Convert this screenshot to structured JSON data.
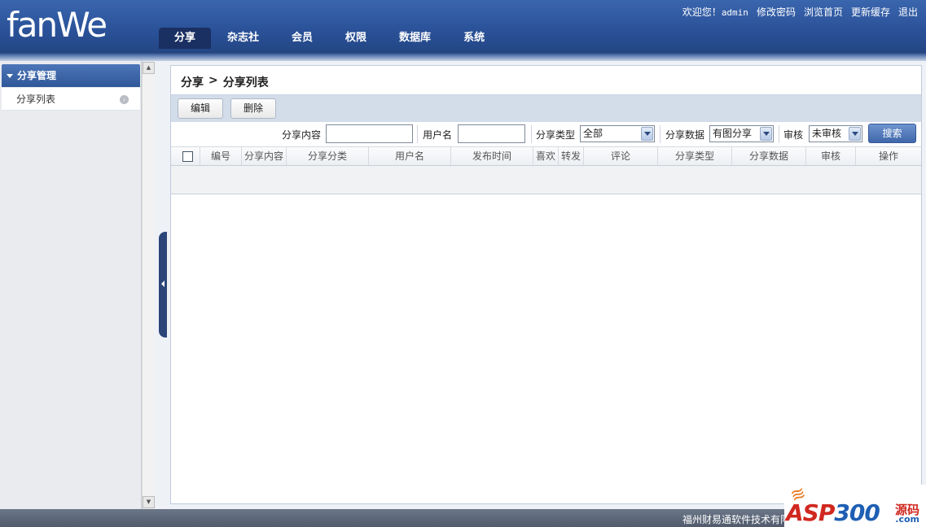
{
  "header": {
    "logo_text": "fanWe",
    "welcome": "欢迎您！",
    "username": "admin",
    "links": [
      "修改密码",
      "浏览首页",
      "更新缓存",
      "退出"
    ],
    "tabs": [
      "分享",
      "杂志社",
      "会员",
      "权限",
      "数据库",
      "系统"
    ],
    "active_tab": "分享"
  },
  "sidebar": {
    "section_title": "分享管理",
    "items": [
      {
        "label": "分享列表"
      }
    ]
  },
  "main": {
    "breadcrumb": [
      "分享",
      ">",
      "分享列表"
    ],
    "toolbar": {
      "edit_label": "编辑",
      "delete_label": "删除"
    },
    "filters": {
      "content_label": "分享内容",
      "content_value": "",
      "username_label": "用户名",
      "username_value": "",
      "type_label": "分享类型",
      "type_value": "全部",
      "data_label": "分享数据",
      "data_value": "有图分享",
      "status_label": "审核",
      "status_value": "未审核",
      "search_label": "搜索"
    },
    "columns": [
      "编号",
      "分享内容",
      "分享分类",
      "用户名",
      "发布时间",
      "喜欢",
      "转发",
      "评论",
      "分享类型",
      "分享数据",
      "审核",
      "操作"
    ]
  },
  "footer": {
    "text": "福州财易通软件技术有限公司"
  },
  "watermark": {
    "brand_a": "ASP",
    "brand_b": "300",
    "sub": "源码",
    "com": ".com"
  }
}
